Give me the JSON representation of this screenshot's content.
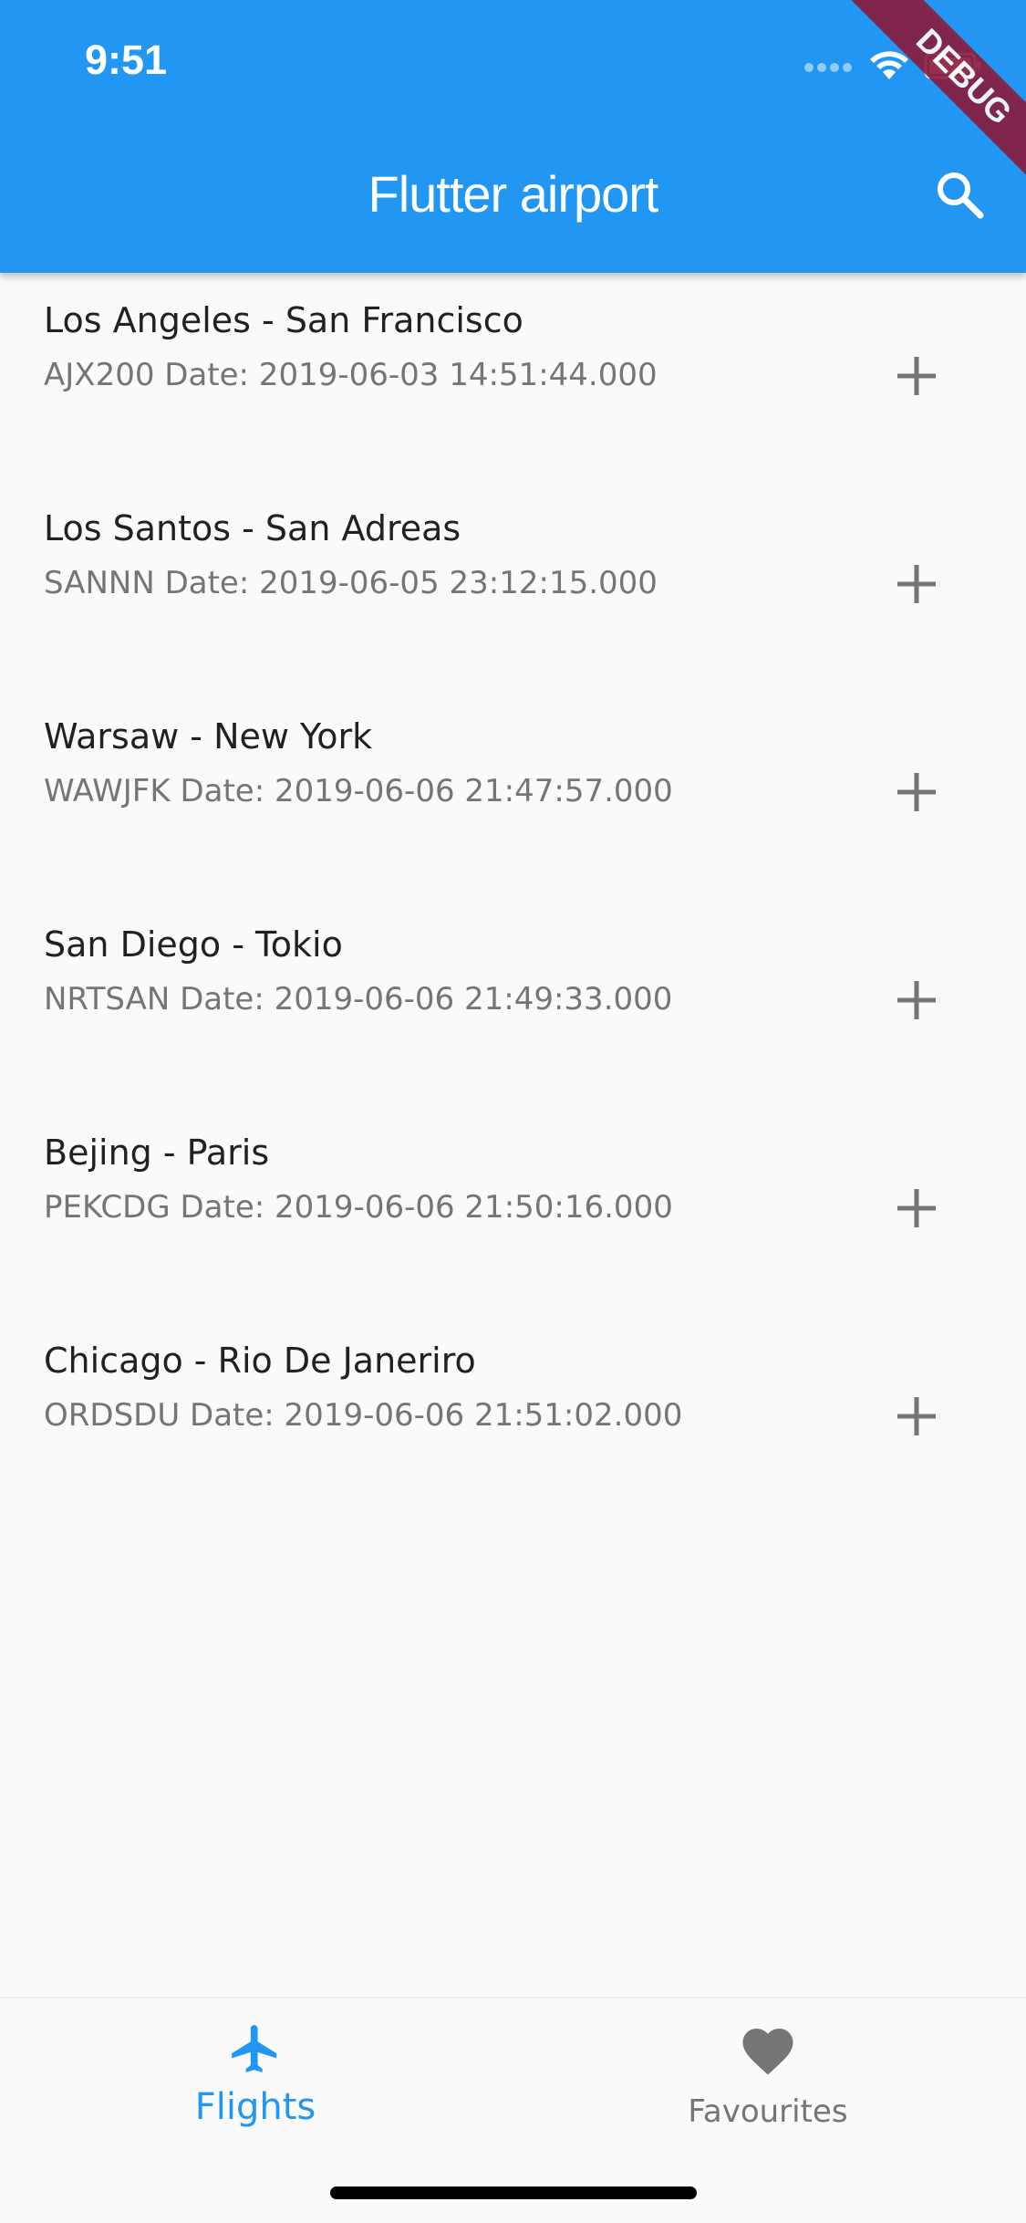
{
  "status_bar": {
    "time": "9:51",
    "icons": [
      "signal-dots-icon",
      "wifi-icon",
      "battery-icon"
    ]
  },
  "app_bar": {
    "title": "Flutter airport",
    "search_icon": "search-icon",
    "background_color": "#2196f3"
  },
  "debug_banner": "DEBUG",
  "flights": [
    {
      "route": "Los Angeles - San Francisco",
      "detail": "AJX200 Date: 2019-06-03 14:51:44.000"
    },
    {
      "route": "Los Santos - San Adreas",
      "detail": "SANNN Date: 2019-06-05 23:12:15.000"
    },
    {
      "route": "Warsaw - New York",
      "detail": "WAWJFK Date: 2019-06-06 21:47:57.000"
    },
    {
      "route": "San Diego - Tokio",
      "detail": "NRTSAN Date: 2019-06-06 21:49:33.000"
    },
    {
      "route": "Bejing - Paris",
      "detail": "PEKCDG Date: 2019-06-06 21:50:16.000"
    },
    {
      "route": "Chicago - Rio De Janeriro",
      "detail": "ORDSDU Date: 2019-06-06 21:51:02.000"
    }
  ],
  "bottom_nav": {
    "items": [
      {
        "label": "Flights",
        "icon": "airplane-icon",
        "active": true
      },
      {
        "label": "Favourites",
        "icon": "heart-icon",
        "active": false
      }
    ],
    "active_color": "#2196f3",
    "inactive_color": "#757575"
  }
}
